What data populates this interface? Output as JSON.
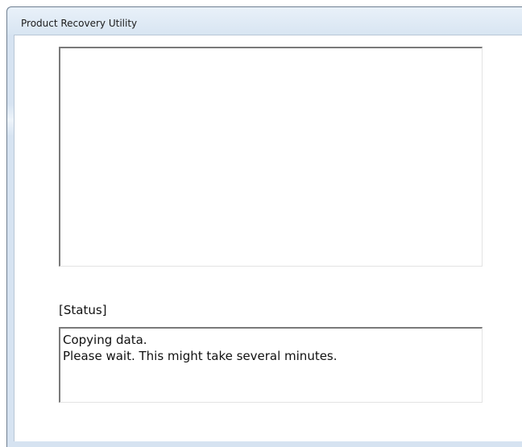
{
  "window": {
    "title": "Product Recovery Utility"
  },
  "status": {
    "label": "[Status]",
    "lines": [
      "Copying data.",
      "Please wait. This might take several minutes."
    ]
  }
}
